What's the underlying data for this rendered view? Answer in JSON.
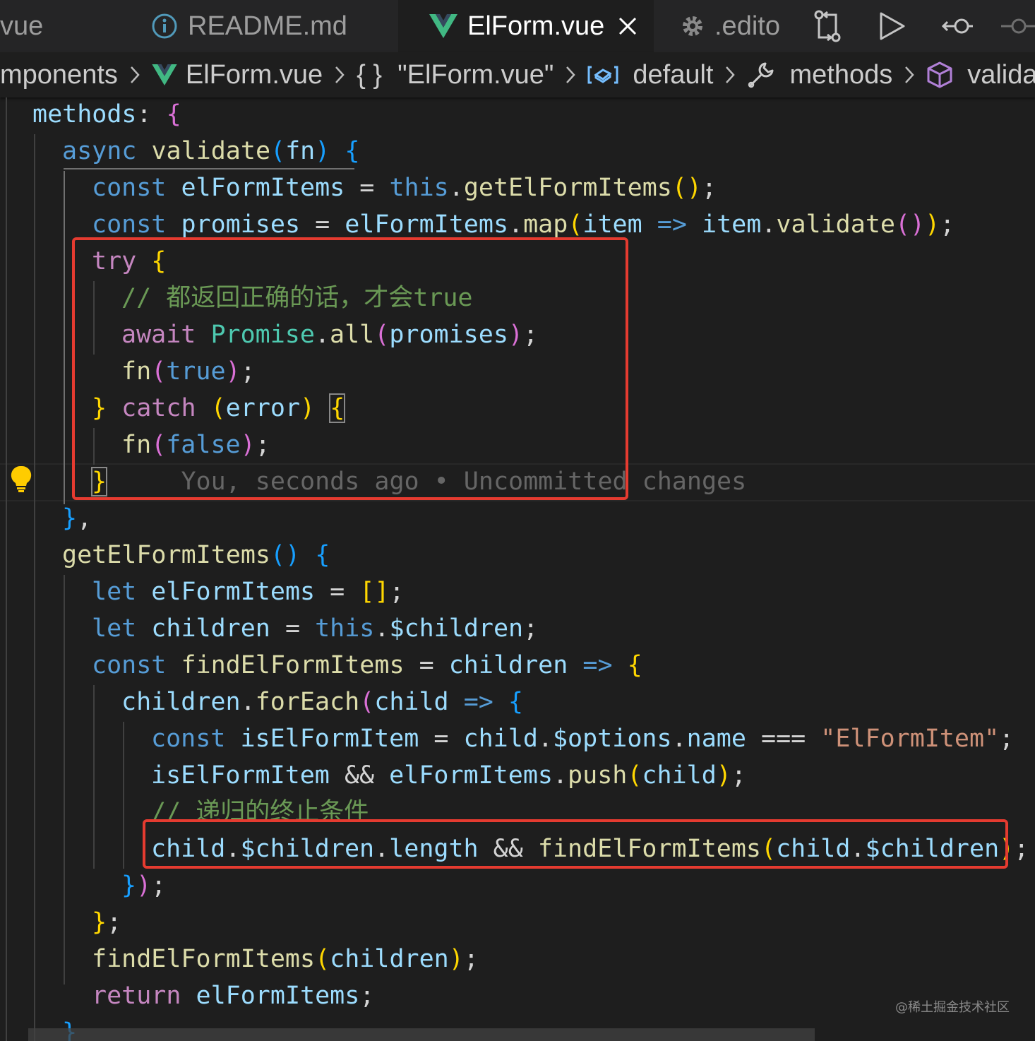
{
  "tabs": [
    {
      "label": "vue"
    },
    {
      "label": "README.md"
    },
    {
      "label": "ElForm.vue"
    },
    {
      "label": ".edito"
    }
  ],
  "breadcrumb": {
    "items": [
      "mponents",
      "ElForm.vue",
      "\"ElForm.vue\"",
      "default",
      "methods",
      "valida"
    ],
    "braces_glyph": "{ }"
  },
  "editor": {
    "lines": [
      [
        [
          "va",
          "methods"
        ],
        [
          "pl",
          ": "
        ],
        [
          "b2",
          "{"
        ]
      ],
      [
        [
          "st",
          "async "
        ],
        [
          "fn",
          "validate"
        ],
        [
          "b3",
          "("
        ],
        [
          "va",
          "fn"
        ],
        [
          "b3",
          ")"
        ],
        [
          "pl",
          " "
        ],
        [
          "b3",
          "{"
        ]
      ],
      [
        [
          "st",
          "const "
        ],
        [
          "va",
          "elFormItems"
        ],
        [
          "pl",
          " = "
        ],
        [
          "st",
          "this"
        ],
        [
          "pl",
          "."
        ],
        [
          "fn",
          "getElFormItems"
        ],
        [
          "b1",
          "()"
        ],
        [
          "pl",
          ";"
        ]
      ],
      [
        [
          "st",
          "const "
        ],
        [
          "va",
          "promises"
        ],
        [
          "pl",
          " = "
        ],
        [
          "va",
          "elFormItems"
        ],
        [
          "pl",
          "."
        ],
        [
          "fn",
          "map"
        ],
        [
          "b1",
          "("
        ],
        [
          "va",
          "item"
        ],
        [
          "pl",
          " "
        ],
        [
          "st",
          "=>"
        ],
        [
          "pl",
          " "
        ],
        [
          "va",
          "item"
        ],
        [
          "pl",
          "."
        ],
        [
          "fn",
          "validate"
        ],
        [
          "b2",
          "()"
        ],
        [
          "b1",
          ")"
        ],
        [
          "pl",
          ";"
        ]
      ],
      [
        [
          "kw",
          "try "
        ],
        [
          "b1",
          "{"
        ]
      ],
      [
        [
          "cm",
          "// 都返回正确的话，才会true"
        ]
      ],
      [
        [
          "kw",
          "await "
        ],
        [
          "cl",
          "Promise"
        ],
        [
          "pl",
          "."
        ],
        [
          "fn",
          "all"
        ],
        [
          "b2",
          "("
        ],
        [
          "va",
          "promises"
        ],
        [
          "b2",
          ")"
        ],
        [
          "pl",
          ";"
        ]
      ],
      [
        [
          "fn",
          "fn"
        ],
        [
          "b2",
          "("
        ],
        [
          "st",
          "true"
        ],
        [
          "b2",
          ")"
        ],
        [
          "pl",
          ";"
        ]
      ],
      [
        [
          "b1",
          "}"
        ],
        [
          "pl",
          " "
        ],
        [
          "kw",
          "catch "
        ],
        [
          "b1",
          "("
        ],
        [
          "va",
          "error"
        ],
        [
          "b1",
          ")"
        ],
        [
          "pl",
          " "
        ],
        [
          "b1m",
          "{"
        ]
      ],
      [
        [
          "fn",
          "fn"
        ],
        [
          "b2",
          "("
        ],
        [
          "st",
          "false"
        ],
        [
          "b2",
          ")"
        ],
        [
          "pl",
          ";"
        ]
      ],
      [
        [
          "b1m",
          "}"
        ],
        [
          "pl",
          "     "
        ],
        [
          "bl",
          "You, seconds ago • Uncommitted changes"
        ]
      ],
      [
        [
          "b3",
          "}"
        ],
        [
          "pl",
          ","
        ]
      ],
      [
        [
          "fn",
          "getElFormItems"
        ],
        [
          "b3",
          "()"
        ],
        [
          "pl",
          " "
        ],
        [
          "b3",
          "{"
        ]
      ],
      [
        [
          "st",
          "let "
        ],
        [
          "va",
          "elFormItems"
        ],
        [
          "pl",
          " = "
        ],
        [
          "b1",
          "[]"
        ],
        [
          "pl",
          ";"
        ]
      ],
      [
        [
          "st",
          "let "
        ],
        [
          "va",
          "children"
        ],
        [
          "pl",
          " = "
        ],
        [
          "st",
          "this"
        ],
        [
          "pl",
          "."
        ],
        [
          "va",
          "$children"
        ],
        [
          "pl",
          ";"
        ]
      ],
      [
        [
          "st",
          "const "
        ],
        [
          "fn",
          "findElFormItems"
        ],
        [
          "pl",
          " = "
        ],
        [
          "va",
          "children"
        ],
        [
          "pl",
          " "
        ],
        [
          "st",
          "=>"
        ],
        [
          "pl",
          " "
        ],
        [
          "b1",
          "{"
        ]
      ],
      [
        [
          "va",
          "children"
        ],
        [
          "pl",
          "."
        ],
        [
          "fn",
          "forEach"
        ],
        [
          "b2",
          "("
        ],
        [
          "va",
          "child"
        ],
        [
          "pl",
          " "
        ],
        [
          "st",
          "=>"
        ],
        [
          "pl",
          " "
        ],
        [
          "b3",
          "{"
        ]
      ],
      [
        [
          "st",
          "const "
        ],
        [
          "va",
          "isElFormItem"
        ],
        [
          "pl",
          " = "
        ],
        [
          "va",
          "child"
        ],
        [
          "pl",
          "."
        ],
        [
          "va",
          "$options"
        ],
        [
          "pl",
          "."
        ],
        [
          "va",
          "name"
        ],
        [
          "pl",
          " === "
        ],
        [
          "str",
          "\"ElFormItem\""
        ],
        [
          "pl",
          ";"
        ]
      ],
      [
        [
          "va",
          "isElFormItem"
        ],
        [
          "pl",
          " && "
        ],
        [
          "va",
          "elFormItems"
        ],
        [
          "pl",
          "."
        ],
        [
          "fn",
          "push"
        ],
        [
          "b1",
          "("
        ],
        [
          "va",
          "child"
        ],
        [
          "b1",
          ")"
        ],
        [
          "pl",
          ";"
        ]
      ],
      [
        [
          "cm",
          "// 递归的终止条件"
        ]
      ],
      [
        [
          "va",
          "child"
        ],
        [
          "pl",
          "."
        ],
        [
          "va",
          "$children"
        ],
        [
          "pl",
          "."
        ],
        [
          "va",
          "length"
        ],
        [
          "pl",
          " && "
        ],
        [
          "fn",
          "findElFormItems"
        ],
        [
          "b1",
          "("
        ],
        [
          "va",
          "child"
        ],
        [
          "pl",
          "."
        ],
        [
          "va",
          "$children"
        ],
        [
          "b1",
          ")"
        ],
        [
          "pl",
          ";"
        ]
      ],
      [
        [
          "b3",
          "}"
        ],
        [
          "b2",
          ")"
        ],
        [
          "pl",
          ";"
        ]
      ],
      [
        [
          "b1",
          "}"
        ],
        [
          "pl",
          ";"
        ]
      ],
      [
        [
          "fn",
          "findElFormItems"
        ],
        [
          "b1",
          "("
        ],
        [
          "va",
          "children"
        ],
        [
          "b1",
          ")"
        ],
        [
          "pl",
          ";"
        ]
      ],
      [
        [
          "kw",
          "return "
        ],
        [
          "va",
          "elFormItems"
        ],
        [
          "pl",
          ";"
        ]
      ],
      [
        [
          "b3",
          "}"
        ]
      ]
    ]
  },
  "watermark": "@稀土掘金技术社区"
}
